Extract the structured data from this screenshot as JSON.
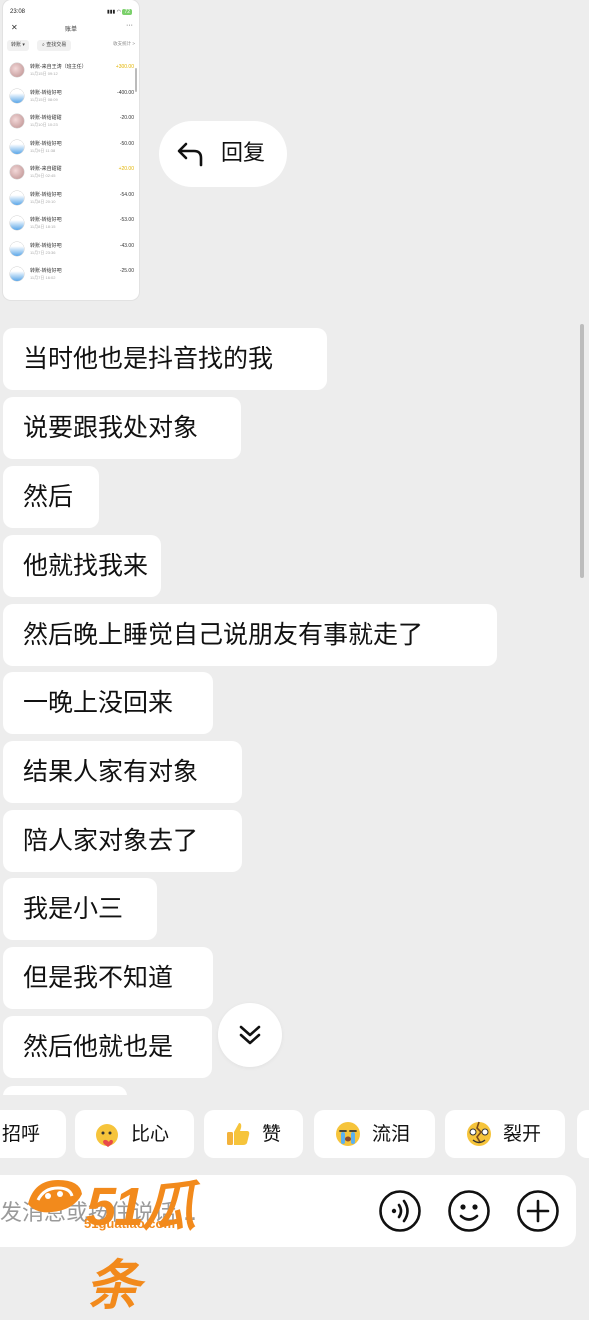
{
  "thumbnail": {
    "status_time": "23:08",
    "battery": "72",
    "title": "账单",
    "filter_label": "转账 ▾",
    "search_label": "查找交易",
    "date_label": "收支统计 >",
    "rows": [
      {
        "name": "转账-来自王涛（班主任）",
        "time": "11月15日 09:12",
        "amount": "+300.00",
        "positive": true,
        "avatar": "pink"
      },
      {
        "name": "转账-转给好吧",
        "time": "11月15日 08:09",
        "amount": "-400.00",
        "positive": false,
        "avatar": "sky"
      },
      {
        "name": "转账-转给甜甜",
        "time": "11月10日 10:23",
        "amount": "-20.00",
        "positive": false,
        "avatar": "pink"
      },
      {
        "name": "转账-转给好吧",
        "time": "11月9日 11:38",
        "amount": "-50.00",
        "positive": false,
        "avatar": "sky"
      },
      {
        "name": "转账-来自甜甜",
        "time": "11月9日 02:45",
        "amount": "+20.00",
        "positive": true,
        "avatar": "pink"
      },
      {
        "name": "转账-转给好吧",
        "time": "11月8日 20:10",
        "amount": "-54.00",
        "positive": false,
        "avatar": "sky"
      },
      {
        "name": "转账-转给好吧",
        "time": "11月8日 18:15",
        "amount": "-53.00",
        "positive": false,
        "avatar": "sky"
      },
      {
        "name": "转账-转给好吧",
        "time": "11月7日 23:36",
        "amount": "-43.00",
        "positive": false,
        "avatar": "sky"
      },
      {
        "name": "转账-转给好吧",
        "time": "11月7日 16:02",
        "amount": "-25.00",
        "positive": false,
        "avatar": "sky"
      }
    ]
  },
  "reply_button": {
    "label": "回复"
  },
  "messages": [
    "当时他也是抖音找的我",
    "说要跟我处对象",
    "然后",
    "他就找我来",
    "然后晚上睡觉自己说朋友有事就走了",
    "一晚上没回来",
    "结果人家有对象",
    "陪人家对象去了",
    "我是小三",
    "但是我不知道",
    "然后他就也是"
  ],
  "quick_reactions": [
    {
      "label": "招呼",
      "emoji": "wave-emoji"
    },
    {
      "label": "比心",
      "emoji": "heart-hands-emoji"
    },
    {
      "label": "赞",
      "emoji": "thumbs-up-emoji"
    },
    {
      "label": "流泪",
      "emoji": "crying-emoji"
    },
    {
      "label": "裂开",
      "emoji": "cracked-emoji"
    }
  ],
  "input": {
    "placeholder": "发消息或按住说话..."
  },
  "watermark": {
    "brand": "51瓜条",
    "url": "51guatiao.com"
  },
  "colors": {
    "background": "#ededed",
    "bubble": "#ffffff",
    "watermark": "#f28a1c",
    "positive_amount": "#e3b400"
  },
  "icons": [
    "reply-arrow-icon",
    "chevron-double-down-icon",
    "voice-icon",
    "emoji-icon",
    "plus-icon"
  ]
}
